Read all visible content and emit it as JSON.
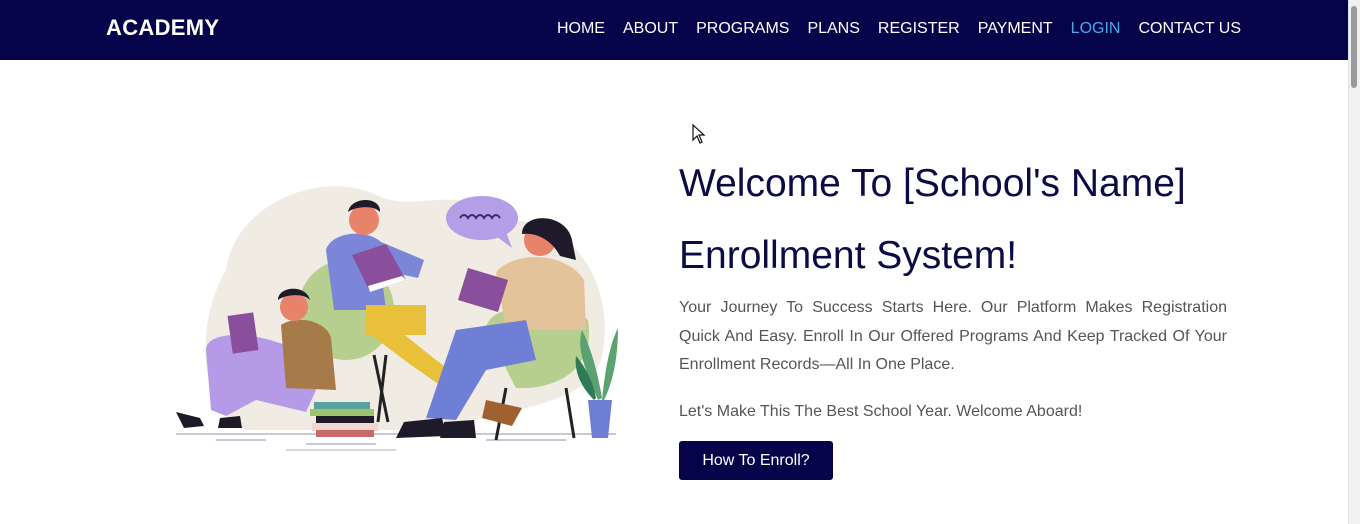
{
  "header": {
    "brand": "ACADEMY",
    "nav": [
      {
        "label": "HOME",
        "active": false
      },
      {
        "label": "ABOUT",
        "active": false
      },
      {
        "label": "PROGRAMS",
        "active": false
      },
      {
        "label": "PLANS",
        "active": false
      },
      {
        "label": "REGISTER",
        "active": false
      },
      {
        "label": "PAYMENT",
        "active": false
      },
      {
        "label": "LOGIN",
        "active": true
      },
      {
        "label": "CONTACT US",
        "active": false
      }
    ]
  },
  "hero": {
    "title": "Welcome To [School's Name] Enrollment System!",
    "description": "Your Journey To Success Starts Here. Our Platform Makes Registration Quick And Easy. Enroll In Our Offered Programs And Keep Tracked Of Your Enrollment Records—All In One Place.",
    "tagline": "Let's Make This The Best School Year. Welcome Aboard!",
    "cta_label": "How To Enroll?",
    "speech_bubble": "eeee"
  },
  "colors": {
    "navbar": "#05044a",
    "active_link": "#4aa8e8",
    "title": "#0b0b45",
    "body_text": "#555555"
  },
  "icons": {
    "cursor": "mouse-pointer-icon",
    "illustration": "students-reading-illustration"
  }
}
